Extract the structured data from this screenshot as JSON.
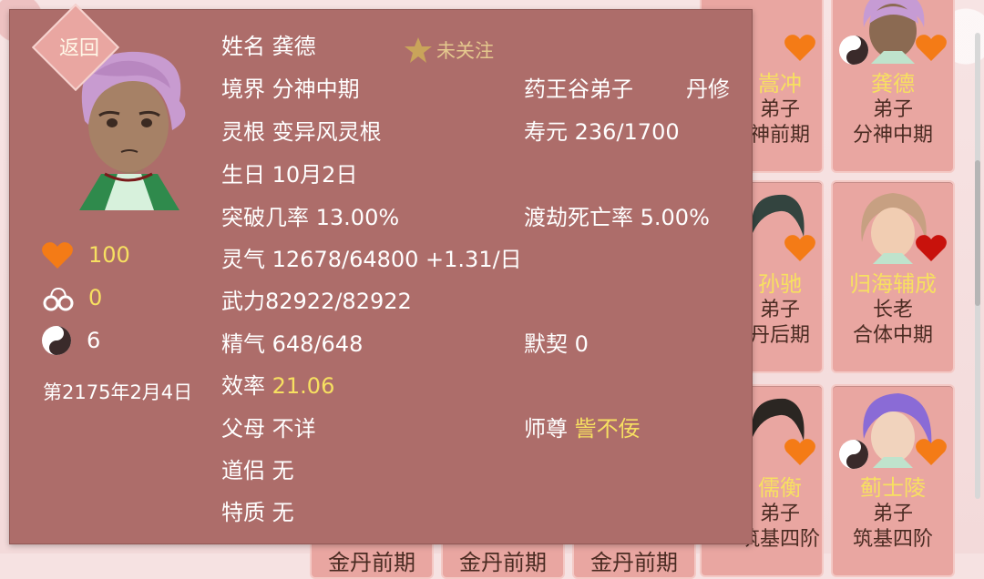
{
  "background_cards": [
    {
      "name": "龚德",
      "rank": "弟子",
      "realm": "分神中期",
      "heart_color": "#f47b16",
      "has_yinyang": true
    },
    {
      "name": "归海辅成",
      "rank": "长老",
      "realm": "合体中期",
      "heart_color": "#c8120c",
      "has_yinyang": false
    },
    {
      "name": "蓟士陵",
      "rank": "弟子",
      "realm": "筑基四阶",
      "heart_color": "#f47b16",
      "has_yinyang": true
    }
  ],
  "partial_cards": [
    {
      "name": "嵩冲",
      "rank": "弟子",
      "realm": "神前期"
    },
    {
      "name": "孙驰",
      "rank": "弟子",
      "realm": "丹后期"
    },
    {
      "name": "儒衡",
      "rank": "弟子",
      "realm": "筑基四阶"
    }
  ],
  "bottom_strip": [
    "金丹前期",
    "金丹前期",
    "金丹前期",
    "筑基四阶"
  ],
  "panel": {
    "back_label": "返回",
    "follow_label": "未关注",
    "hearts": "100",
    "handcuffs": "0",
    "yinyang": "6",
    "date": "第2175年2月4日",
    "name_label": "姓名",
    "name": "龚德",
    "realm_label": "境界",
    "realm": "分神中期",
    "sect": "药王谷弟子",
    "profession": "丹修",
    "root_label": "灵根",
    "root": "变异风灵根",
    "life_label": "寿元",
    "life": "236/1700",
    "birthday_label": "生日",
    "birthday": "10月2日",
    "breakthrough_label": "突破几率",
    "breakthrough": "13.00%",
    "tribulation_label": "渡劫死亡率",
    "tribulation": "5.00%",
    "spirit_label": "灵气",
    "spirit": "12678/64800 +1.31/日",
    "force_label": "武力",
    "force": "82922/82922",
    "essence_label": "精气",
    "essence": "648/648",
    "tacit_label": "默契",
    "tacit": "0",
    "efficiency_label": "效率",
    "efficiency": "21.06",
    "parents_label": "父母",
    "parents": "不详",
    "master_label": "师尊",
    "master": "訾不佞",
    "partner_label": "道侣",
    "partner": "无",
    "trait_label": "特质",
    "trait": "无"
  }
}
